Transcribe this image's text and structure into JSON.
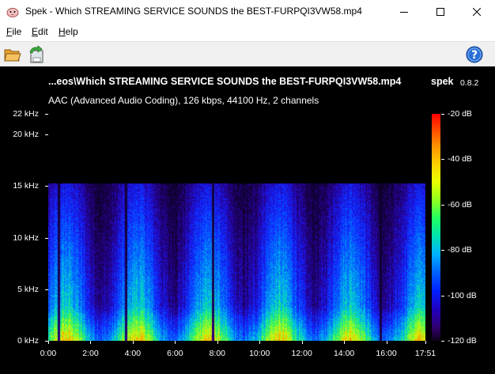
{
  "window": {
    "title": "Spek - Which STREAMING SERVICE SOUNDS the BEST-FURPQI3VW58.mp4"
  },
  "menu": {
    "items": [
      {
        "label": "File",
        "accel": "F",
        "rest": "ile"
      },
      {
        "label": "Edit",
        "accel": "E",
        "rest": "dit"
      },
      {
        "label": "Help",
        "accel": "H",
        "rest": "elp"
      }
    ]
  },
  "toolbar": {
    "icons": [
      "open-folder-icon",
      "save-icon",
      "help-icon"
    ]
  },
  "spek": {
    "file_title": "...eos\\Which STREAMING SERVICE SOUNDS the BEST-FURPQI3VW58.mp4",
    "app_name": "spek",
    "version": "0.8.2",
    "codec_info": "AAC (Advanced Audio Coding), 126 kbps, 44100 Hz, 2 channels",
    "y_ticks": [
      "22 kHz",
      "20 kHz",
      "15 kHz",
      "10 kHz",
      "5 kHz",
      "0 kHz"
    ],
    "y_tick_values_khz": [
      22,
      20,
      15,
      10,
      5,
      0
    ],
    "x_ticks": [
      "0:00",
      "2:00",
      "4:00",
      "6:00",
      "8:00",
      "10:00",
      "12:00",
      "14:00",
      "16:00",
      "17:51"
    ],
    "x_tick_values_sec": [
      0,
      120,
      240,
      360,
      480,
      600,
      720,
      840,
      960,
      1071
    ],
    "db_ticks": [
      "-20 dB",
      "-40 dB",
      "-60 dB",
      "-80 dB",
      "-100 dB",
      "-120 dB"
    ],
    "db_tick_values": [
      -20,
      -40,
      -60,
      -80,
      -100,
      -120
    ],
    "cutoff_khz": 15.3,
    "duration_sec": 1071,
    "max_khz": 22
  }
}
